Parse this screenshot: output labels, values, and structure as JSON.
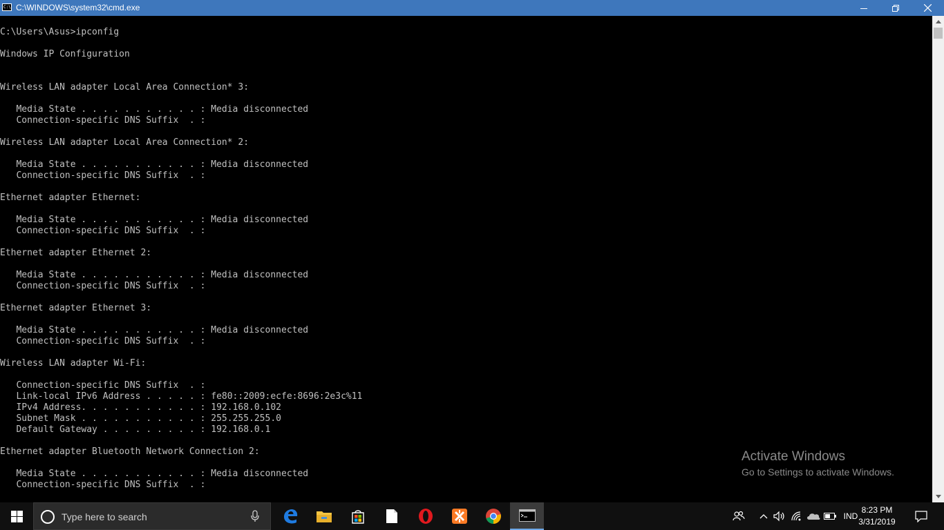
{
  "window": {
    "title": "C:\\WINDOWS\\system32\\cmd.exe",
    "icon_text": "C:\\"
  },
  "console": {
    "text": "C:\\Users\\Asus>ipconfig\n\nWindows IP Configuration\n\n\nWireless LAN adapter Local Area Connection* 3:\n\n   Media State . . . . . . . . . . . : Media disconnected\n   Connection-specific DNS Suffix  . :\n\nWireless LAN adapter Local Area Connection* 2:\n\n   Media State . . . . . . . . . . . : Media disconnected\n   Connection-specific DNS Suffix  . :\n\nEthernet adapter Ethernet:\n\n   Media State . . . . . . . . . . . : Media disconnected\n   Connection-specific DNS Suffix  . :\n\nEthernet adapter Ethernet 2:\n\n   Media State . . . . . . . . . . . : Media disconnected\n   Connection-specific DNS Suffix  . :\n\nEthernet adapter Ethernet 3:\n\n   Media State . . . . . . . . . . . : Media disconnected\n   Connection-specific DNS Suffix  . :\n\nWireless LAN adapter Wi-Fi:\n\n   Connection-specific DNS Suffix  . :\n   Link-local IPv6 Address . . . . . : fe80::2009:ecfe:8696:2e3c%11\n   IPv4 Address. . . . . . . . . . . : 192.168.0.102\n   Subnet Mask . . . . . . . . . . . : 255.255.255.0\n   Default Gateway . . . . . . . . . : 192.168.0.1\n\nEthernet adapter Bluetooth Network Connection 2:\n\n   Media State . . . . . . . . . . . : Media disconnected\n   Connection-specific DNS Suffix  . :"
  },
  "watermark": {
    "title": "Activate Windows",
    "subtitle": "Go to Settings to activate Windows."
  },
  "taskbar": {
    "search_placeholder": "Type here to search",
    "apps": [
      "edge-icon",
      "file-explorer-icon",
      "store-icon",
      "document-icon",
      "opera-icon",
      "xampp-icon",
      "chrome-icon",
      "cmd-icon"
    ],
    "language": "IND",
    "time": "8:23 PM",
    "date": "3/31/2019"
  },
  "colors": {
    "titlebar": "#3e77bc",
    "console_bg": "#000000",
    "console_text": "#c0c0c0",
    "taskbar": "#101010"
  }
}
